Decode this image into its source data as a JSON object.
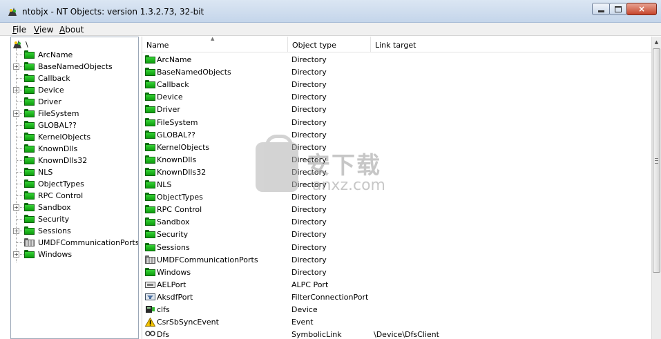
{
  "window": {
    "title": "ntobjx - NT Objects: version 1.3.2.73, 32-bit",
    "controls": {
      "minimize": "minimize-icon",
      "maximize": "maximize-icon",
      "close": "×"
    }
  },
  "menu": {
    "items": [
      {
        "label": "File",
        "accel": "F",
        "rest": "ile"
      },
      {
        "label": "View",
        "accel": "V",
        "rest": "iew"
      },
      {
        "label": "About",
        "accel": "A",
        "rest": "bout"
      }
    ]
  },
  "tree": {
    "root": "\\",
    "items": [
      {
        "label": "ArcName",
        "expandable": false,
        "icon": "folder"
      },
      {
        "label": "BaseNamedObjects",
        "expandable": true,
        "icon": "folder"
      },
      {
        "label": "Callback",
        "expandable": false,
        "icon": "folder"
      },
      {
        "label": "Device",
        "expandable": true,
        "icon": "folder"
      },
      {
        "label": "Driver",
        "expandable": false,
        "icon": "folder"
      },
      {
        "label": "FileSystem",
        "expandable": true,
        "icon": "folder"
      },
      {
        "label": "GLOBAL??",
        "expandable": false,
        "icon": "folder"
      },
      {
        "label": "KernelObjects",
        "expandable": false,
        "icon": "folder"
      },
      {
        "label": "KnownDlls",
        "expandable": false,
        "icon": "folder"
      },
      {
        "label": "KnownDlls32",
        "expandable": false,
        "icon": "folder"
      },
      {
        "label": "NLS",
        "expandable": false,
        "icon": "folder"
      },
      {
        "label": "ObjectTypes",
        "expandable": false,
        "icon": "folder"
      },
      {
        "label": "RPC Control",
        "expandable": false,
        "icon": "folder"
      },
      {
        "label": "Sandbox",
        "expandable": true,
        "icon": "folder"
      },
      {
        "label": "Security",
        "expandable": false,
        "icon": "folder"
      },
      {
        "label": "Sessions",
        "expandable": true,
        "icon": "folder"
      },
      {
        "label": "UMDFCommunicationPorts",
        "expandable": false,
        "icon": "folder-gray"
      },
      {
        "label": "Windows",
        "expandable": true,
        "icon": "folder"
      }
    ]
  },
  "list": {
    "columns": [
      "Name",
      "Object type",
      "Link target"
    ],
    "rows": [
      {
        "name": "ArcName",
        "type": "Directory",
        "target": "",
        "icon": "folder"
      },
      {
        "name": "BaseNamedObjects",
        "type": "Directory",
        "target": "",
        "icon": "folder"
      },
      {
        "name": "Callback",
        "type": "Directory",
        "target": "",
        "icon": "folder"
      },
      {
        "name": "Device",
        "type": "Directory",
        "target": "",
        "icon": "folder"
      },
      {
        "name": "Driver",
        "type": "Directory",
        "target": "",
        "icon": "folder"
      },
      {
        "name": "FileSystem",
        "type": "Directory",
        "target": "",
        "icon": "folder"
      },
      {
        "name": "GLOBAL??",
        "type": "Directory",
        "target": "",
        "icon": "folder"
      },
      {
        "name": "KernelObjects",
        "type": "Directory",
        "target": "",
        "icon": "folder"
      },
      {
        "name": "KnownDlls",
        "type": "Directory",
        "target": "",
        "icon": "folder"
      },
      {
        "name": "KnownDlls32",
        "type": "Directory",
        "target": "",
        "icon": "folder"
      },
      {
        "name": "NLS",
        "type": "Directory",
        "target": "",
        "icon": "folder"
      },
      {
        "name": "ObjectTypes",
        "type": "Directory",
        "target": "",
        "icon": "folder"
      },
      {
        "name": "RPC Control",
        "type": "Directory",
        "target": "",
        "icon": "folder"
      },
      {
        "name": "Sandbox",
        "type": "Directory",
        "target": "",
        "icon": "folder"
      },
      {
        "name": "Security",
        "type": "Directory",
        "target": "",
        "icon": "folder"
      },
      {
        "name": "Sessions",
        "type": "Directory",
        "target": "",
        "icon": "folder"
      },
      {
        "name": "UMDFCommunicationPorts",
        "type": "Directory",
        "target": "",
        "icon": "folder-gray"
      },
      {
        "name": "Windows",
        "type": "Directory",
        "target": "",
        "icon": "folder"
      },
      {
        "name": "AELPort",
        "type": "ALPC Port",
        "target": "",
        "icon": "port"
      },
      {
        "name": "AksdfPort",
        "type": "FilterConnectionPort",
        "target": "",
        "icon": "filter-port"
      },
      {
        "name": "clfs",
        "type": "Device",
        "target": "",
        "icon": "device"
      },
      {
        "name": "CsrSbSyncEvent",
        "type": "Event",
        "target": "",
        "icon": "event"
      },
      {
        "name": "Dfs",
        "type": "SymbolicLink",
        "target": "\\Device\\DfsClient",
        "icon": "symlink"
      }
    ]
  },
  "watermark": {
    "text": "安下载",
    "url": "anxz.com"
  }
}
